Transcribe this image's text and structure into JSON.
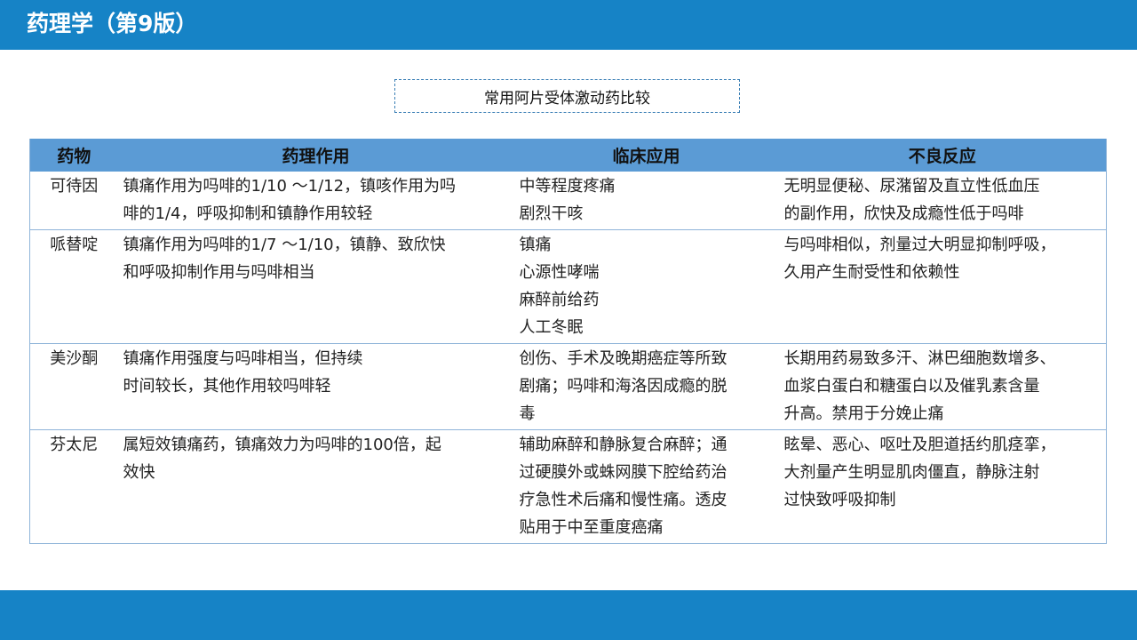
{
  "header": {
    "title": "药理学（第9版）"
  },
  "caption": "常用阿片受体激动药比较",
  "table": {
    "columns": [
      "药物",
      "药理作用",
      "临床应用",
      "不良反应"
    ],
    "rows": [
      {
        "drug": "可待因",
        "pharmacology": [
          "镇痛作用为吗啡的1/10 ～1/12，镇咳作用为吗",
          "啡的1/4，呼吸抑制和镇静作用较轻"
        ],
        "clinical": [
          "中等程度疼痛",
          "剧烈干咳"
        ],
        "adverse": [
          "无明显便秘、尿潴留及直立性低血压",
          "的副作用，欣快及成瘾性低于吗啡"
        ]
      },
      {
        "drug": "哌替啶",
        "pharmacology": [
          "镇痛作用为吗啡的1/7 ～1/10，镇静、致欣快",
          "和呼吸抑制作用与吗啡相当"
        ],
        "clinical": [
          "镇痛",
          "心源性哮喘",
          "麻醉前给药",
          "人工冬眠"
        ],
        "adverse": [
          "与吗啡相似，剂量过大明显抑制呼吸，",
          "久用产生耐受性和依赖性"
        ]
      },
      {
        "drug": "美沙酮",
        "pharmacology": [
          "镇痛作用强度与吗啡相当，但持续",
          "时间较长，其他作用较吗啡轻"
        ],
        "clinical": [
          "创伤、手术及晚期癌症等所致",
          "剧痛；吗啡和海洛因成瘾的脱",
          "毒"
        ],
        "adverse": [
          "长期用药易致多汗、淋巴细胞数增多、",
          "血浆白蛋白和糖蛋白以及催乳素含量",
          "升高。禁用于分娩止痛"
        ]
      },
      {
        "drug": "芬太尼",
        "pharmacology": [
          "属短效镇痛药，镇痛效力为吗啡的100倍，起",
          "效快"
        ],
        "clinical": [
          "辅助麻醉和静脉复合麻醉；通",
          "过硬膜外或蛛网膜下腔给药治",
          "疗急性术后痛和慢性痛。透皮",
          "贴用于中至重度癌痛"
        ],
        "adverse": [
          "眩晕、恶心、呕吐及胆道括约肌痉挛，",
          "大剂量产生明显肌肉僵直，静脉注射",
          "过快致呼吸抑制"
        ]
      }
    ]
  },
  "colors": {
    "bar": "#1683c6",
    "table_header": "#5b9bd5",
    "row_border": "#8fb4d9"
  }
}
